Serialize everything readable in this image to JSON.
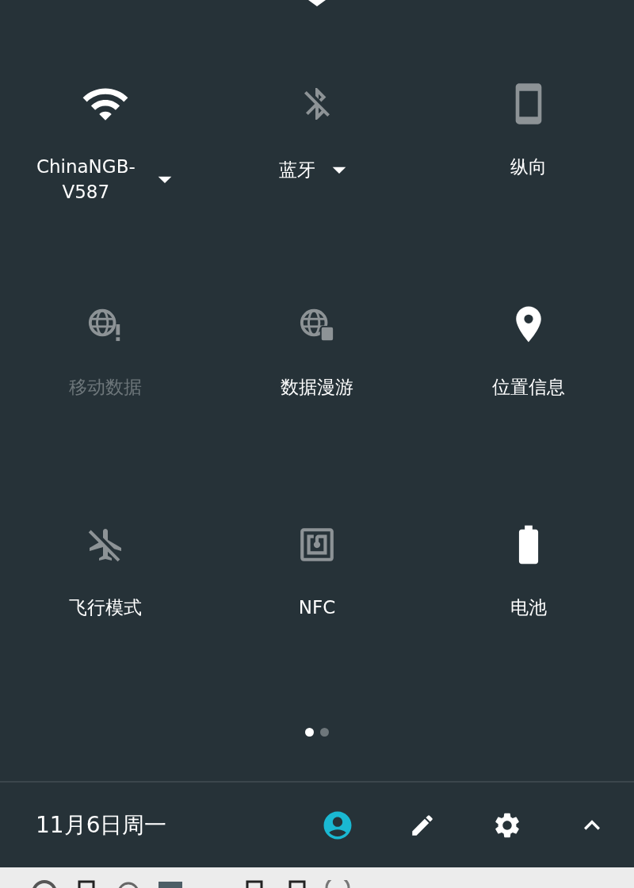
{
  "tiles": [
    {
      "kind": "wifi",
      "label": "ChinaNGB-V587",
      "on": true,
      "disabled": false,
      "dropdown": true
    },
    {
      "kind": "bluetooth",
      "label": "蓝牙",
      "on": false,
      "disabled": false,
      "dropdown": true
    },
    {
      "kind": "portrait",
      "label": "纵向",
      "on": false,
      "disabled": false,
      "dropdown": false
    },
    {
      "kind": "mobiledata",
      "label": "移动数据",
      "on": false,
      "disabled": true,
      "dropdown": false
    },
    {
      "kind": "roaming",
      "label": "数据漫游",
      "on": false,
      "disabled": false,
      "dropdown": false
    },
    {
      "kind": "location",
      "label": "位置信息",
      "on": true,
      "disabled": false,
      "dropdown": false
    },
    {
      "kind": "airplane",
      "label": "飞行模式",
      "on": false,
      "disabled": false,
      "dropdown": false
    },
    {
      "kind": "nfc",
      "label": "NFC",
      "on": false,
      "disabled": false,
      "dropdown": false
    },
    {
      "kind": "battery",
      "label": "电池",
      "on": true,
      "disabled": false,
      "dropdown": false
    }
  ],
  "pages": [
    {
      "selected": true
    },
    {
      "selected": false
    }
  ],
  "footer": {
    "date": "11月6日周一",
    "actions": [
      {
        "kind": "user"
      },
      {
        "kind": "edit"
      },
      {
        "kind": "settings"
      },
      {
        "kind": "collapse"
      }
    ]
  }
}
